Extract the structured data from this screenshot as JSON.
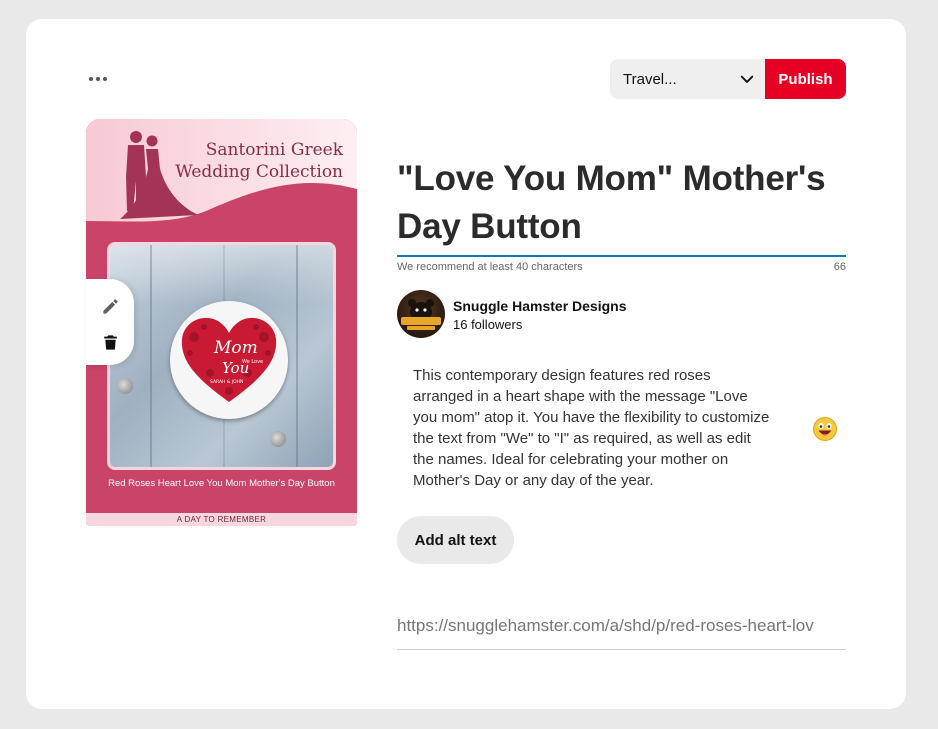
{
  "toolbar": {
    "more_icon": "more-horizontal-icon",
    "board_select_value": "Travel...",
    "publish_label": "Publish",
    "accent_color": "#e60023"
  },
  "pin_image": {
    "header_title": "Santorini Greek Wedding Collection",
    "badge_text_main": "Mom",
    "badge_text_small": "We Love",
    "badge_text_you": "You",
    "badge_text_names": "SARAH & JOHN",
    "caption": "Red Roses Heart Love You Mom Mother's Day Button",
    "footer": "A DAY TO REMEMBER",
    "edit_icon": "pencil-icon",
    "delete_icon": "trash-icon"
  },
  "details": {
    "title": "\"Love You Mom\" Mother's Day Button",
    "title_hint": "We recommend at least 40 characters",
    "char_count": "66",
    "author_name": "Snuggle Hamster Designs",
    "author_followers": "16 followers",
    "avatar_text": "SNUGGLE HAMSTER DESIGNS",
    "description": "This contemporary design features red roses arranged in a heart shape with the message \"Love you mom\" atop it. You have the flexibility to customize the text from \"We\" to \"I\" as required, as well as edit the names. Ideal for celebrating your mother on Mother's Day or any day of the year.",
    "emoji_icon": "emoji-icon",
    "alt_text_button": "Add alt text",
    "link_value": "https://snugglehamster.com/a/shd/p/red-roses-heart-lov"
  }
}
